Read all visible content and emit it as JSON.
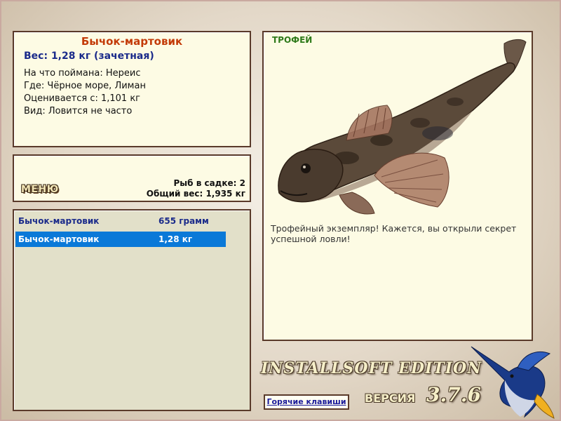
{
  "catch_info": {
    "fish_name": "Бычок-мартовик",
    "weight": "Вес: 1,28 кг (зачетная)",
    "bait": "На что поймана: Нереис",
    "location": "Где: Чёрное море, Лиман",
    "valued_from": "Оценивается с: 1,101 кг",
    "kind": "Вид: Ловится не часто"
  },
  "menu": {
    "menu_label": "МЕНЮ",
    "fish_in_keepnet": "Рыб в садке: 2",
    "total_weight": "Общий вес: 1,935 кг"
  },
  "catch_list": [
    {
      "name": "Бычок-мартовик",
      "weight": "655 грамм",
      "selected": false
    },
    {
      "name": "Бычок-мартовик",
      "weight": "1,28 кг",
      "selected": true
    }
  ],
  "trophy": {
    "tag": "ТРОФЕЙ",
    "description": "Трофейный экземпляр! Кажется, вы открыли секрет успешной ловли!",
    "image": "goby-fish-image"
  },
  "footer": {
    "logo_text": "INSTALLSOFT EDITION",
    "version_label": "ВЕРСИЯ",
    "version_number": "3.7.6",
    "hotkeys_label": "Горячие клавиши",
    "logo_image": "marlin-logo"
  },
  "colors": {
    "title_red": "#c33b08",
    "weight_blue": "#1a2a8a",
    "selection_blue": "#0a79d8",
    "trophy_green": "#2e7a1a",
    "panel_bg": "#fdfbe4"
  }
}
